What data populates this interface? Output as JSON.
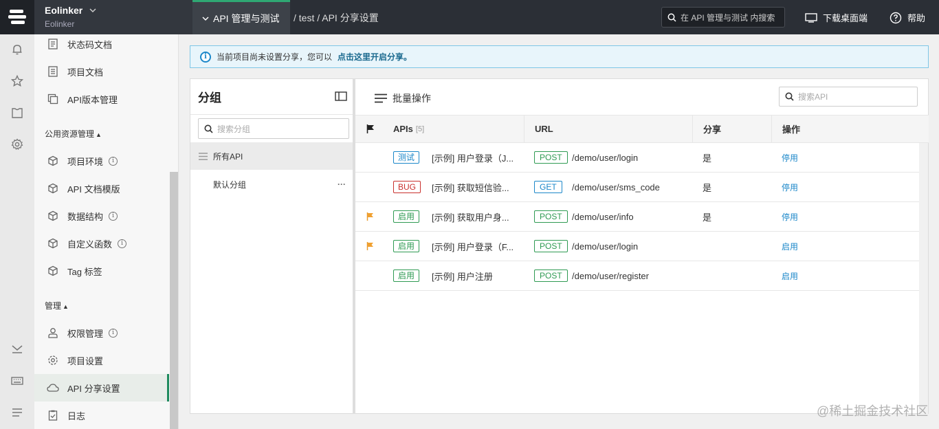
{
  "topbar": {
    "brand_name": "Eolinker",
    "brand_sub": "Eolinker",
    "project_tab": "API 管理与测试",
    "breadcrumb": "/ test / API 分享设置",
    "search_placeholder": "在 API 管理与测试 内搜索",
    "download_label": "下载桌面端",
    "help_label": "帮助"
  },
  "sidebar": {
    "items_top": [
      {
        "label": "状态码文档",
        "icon": "document-icon"
      },
      {
        "label": "项目文档",
        "icon": "list-document-icon"
      },
      {
        "label": "API版本管理",
        "icon": "versions-icon"
      }
    ],
    "section_resources": "公用资源管理",
    "resource_items": [
      {
        "label": "项目环境",
        "info": true
      },
      {
        "label": "API 文档模版",
        "info": false
      },
      {
        "label": "数据结构",
        "info": true
      },
      {
        "label": "自定义函数",
        "info": true
      },
      {
        "label": "Tag 标签",
        "info": false
      }
    ],
    "section_manage": "管理",
    "manage_items": [
      {
        "label": "权限管理",
        "info": true
      },
      {
        "label": "项目设置",
        "info": false
      },
      {
        "label": "API 分享设置",
        "info": false,
        "active": true
      },
      {
        "label": "日志",
        "info": false
      }
    ],
    "info_glyph": "i"
  },
  "notice": {
    "text": "当前项目尚未设置分享，您可以",
    "link": "点击这里开启分享。"
  },
  "groups": {
    "title": "分组",
    "search_placeholder": "搜索分组",
    "all_label": "所有API",
    "default_label": "默认分组",
    "more_glyph": "···"
  },
  "apis": {
    "batch_label": "批量操作",
    "search_placeholder": "搜索API",
    "columns": {
      "apis": "APIs",
      "count": "[5]",
      "url": "URL",
      "share": "分享",
      "action": "操作"
    },
    "rows": [
      {
        "status": "测试",
        "status_color": "blue",
        "name": "[示例] 用户登录（J...",
        "method": "POST",
        "url": "/demo/user/login",
        "share": "是",
        "action": "停用",
        "flagged": false
      },
      {
        "status": "BUG",
        "status_color": "red",
        "name": "[示例] 获取短信验...",
        "method": "GET",
        "url": "/demo/user/sms_code",
        "share": "是",
        "action": "停用",
        "flagged": false
      },
      {
        "status": "启用",
        "status_color": "green",
        "name": "[示例] 获取用户身...",
        "method": "POST",
        "url": "/demo/user/info",
        "share": "是",
        "action": "停用",
        "flagged": true
      },
      {
        "status": "启用",
        "status_color": "green",
        "name": "[示例] 用户登录（F...",
        "method": "POST",
        "url": "/demo/user/login",
        "share": "",
        "action": "启用",
        "flagged": true
      },
      {
        "status": "启用",
        "status_color": "green",
        "name": "[示例] 用户注册",
        "method": "POST",
        "url": "/demo/user/register",
        "share": "",
        "action": "启用",
        "flagged": false
      }
    ]
  },
  "watermark": "@稀土掘金技术社区"
}
